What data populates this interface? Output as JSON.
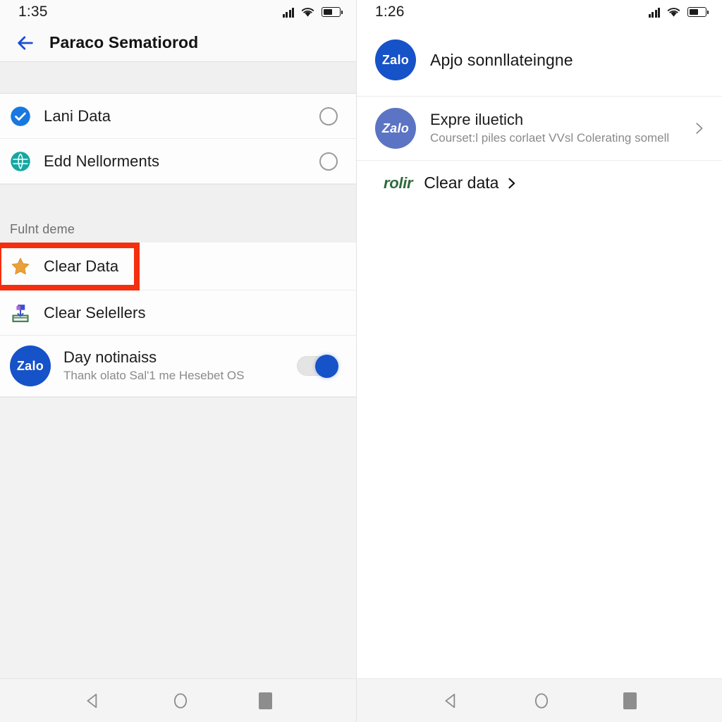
{
  "left": {
    "status": {
      "time": "1:35",
      "signal_icon": "signal-bars-icon",
      "wifi_icon": "wifi-icon",
      "battery_icon": "battery-icon",
      "battery_level": "55%"
    },
    "appbar": {
      "back_icon": "back-arrow-icon",
      "title": "Paraco Sematiorod"
    },
    "items": [
      {
        "icon": "check-circle-icon",
        "label": "Lani Data",
        "trailing": "radio-circle"
      },
      {
        "icon": "globe-circle-icon",
        "label": "Edd Nellorments",
        "trailing": "radio-circle"
      }
    ],
    "section": {
      "label": "Fulnt deme"
    },
    "highlighted": {
      "icon": "star-icon",
      "label": "Clear Data",
      "highlight_color": "#f42f10"
    },
    "secondary": {
      "icon": "save-download-icon",
      "label": "Clear Selellers"
    },
    "notification": {
      "avatar_text": "Zalo",
      "title": "Day notinaiss",
      "subtitle": "Thank olato Sal'1 me Hesebet OS",
      "toggle_state": "on",
      "toggle_color": "#1652c8"
    },
    "nav": {
      "back": "nav-back-icon",
      "home": "nav-home-icon",
      "recents": "nav-recents-icon"
    }
  },
  "right": {
    "status": {
      "time": "1:26",
      "signal_icon": "signal-bars-icon",
      "wifi_icon": "wifi-icon",
      "battery_icon": "battery-icon",
      "battery_level": "55%"
    },
    "header": {
      "avatar_text": "Zalo",
      "title": "Apjo sonnllateingne"
    },
    "row": {
      "avatar_text": "Zalo",
      "title": "Expre iluetich",
      "subtitle": "Courset:l piles corlaet VVsl Colerating somell",
      "chevron_icon": "chevron-right-icon"
    },
    "action": {
      "brand": "rolir",
      "label": "Clear data",
      "chevron_icon": "chevron-right-icon"
    },
    "nav": {
      "back": "nav-back-icon",
      "home": "nav-home-icon",
      "recents": "nav-recents-icon"
    }
  }
}
